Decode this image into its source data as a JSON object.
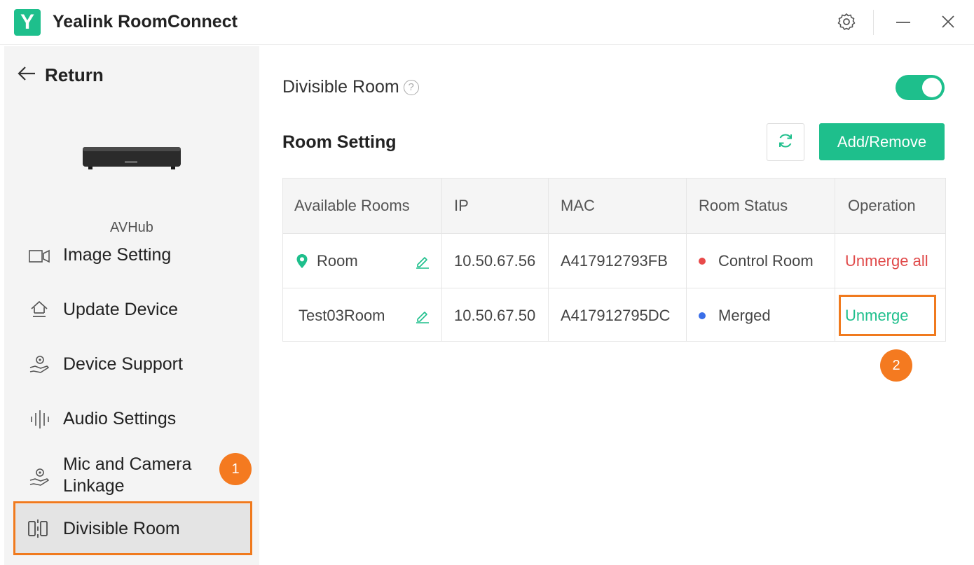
{
  "app": {
    "title": "Yealink RoomConnect",
    "logo_letter": "Y",
    "brand_color": "#1ebf8c"
  },
  "titlebar": {
    "icons": [
      "gear-icon",
      "minimize-icon",
      "close-icon"
    ]
  },
  "sidebar": {
    "return_label": "Return",
    "device_name": "AVHub",
    "items": [
      {
        "label": "Image Setting",
        "icon": "image-setting-icon"
      },
      {
        "label": "Update Device",
        "icon": "update-icon"
      },
      {
        "label": "Device Support",
        "icon": "support-icon"
      },
      {
        "label": "Audio Settings",
        "icon": "audio-wave-icon"
      },
      {
        "label_line1": "Mic and Camera",
        "label_line2": "Linkage",
        "icon": "linkage-icon"
      },
      {
        "label": "Divisible Room",
        "icon": "divisible-room-icon",
        "active": true
      }
    ]
  },
  "annotations": {
    "badge1": "1",
    "badge2": "2",
    "highlight_color": "#f07a1e"
  },
  "main": {
    "divisible_room_label": "Divisible Room",
    "help_glyph": "?",
    "toggle_on": true,
    "room_setting_title": "Room Setting",
    "add_remove_label": "Add/Remove",
    "table": {
      "headers": [
        "Available Rooms",
        "IP",
        "MAC",
        "Room Status",
        "Operation"
      ],
      "rows": [
        {
          "room": "Room",
          "ip": "10.50.67.56",
          "mac": "A417912793FB",
          "status": "Control Room",
          "status_color": "#e84a4a",
          "operation": "Unmerge all",
          "operation_color": "#e04a4a"
        },
        {
          "room": "Test03Room",
          "ip": "10.50.67.50",
          "mac": "A417912795DC",
          "status": "Merged",
          "status_color": "#3a6ee8",
          "operation": "Unmerge",
          "operation_color": "#1ebf8c"
        }
      ]
    }
  }
}
